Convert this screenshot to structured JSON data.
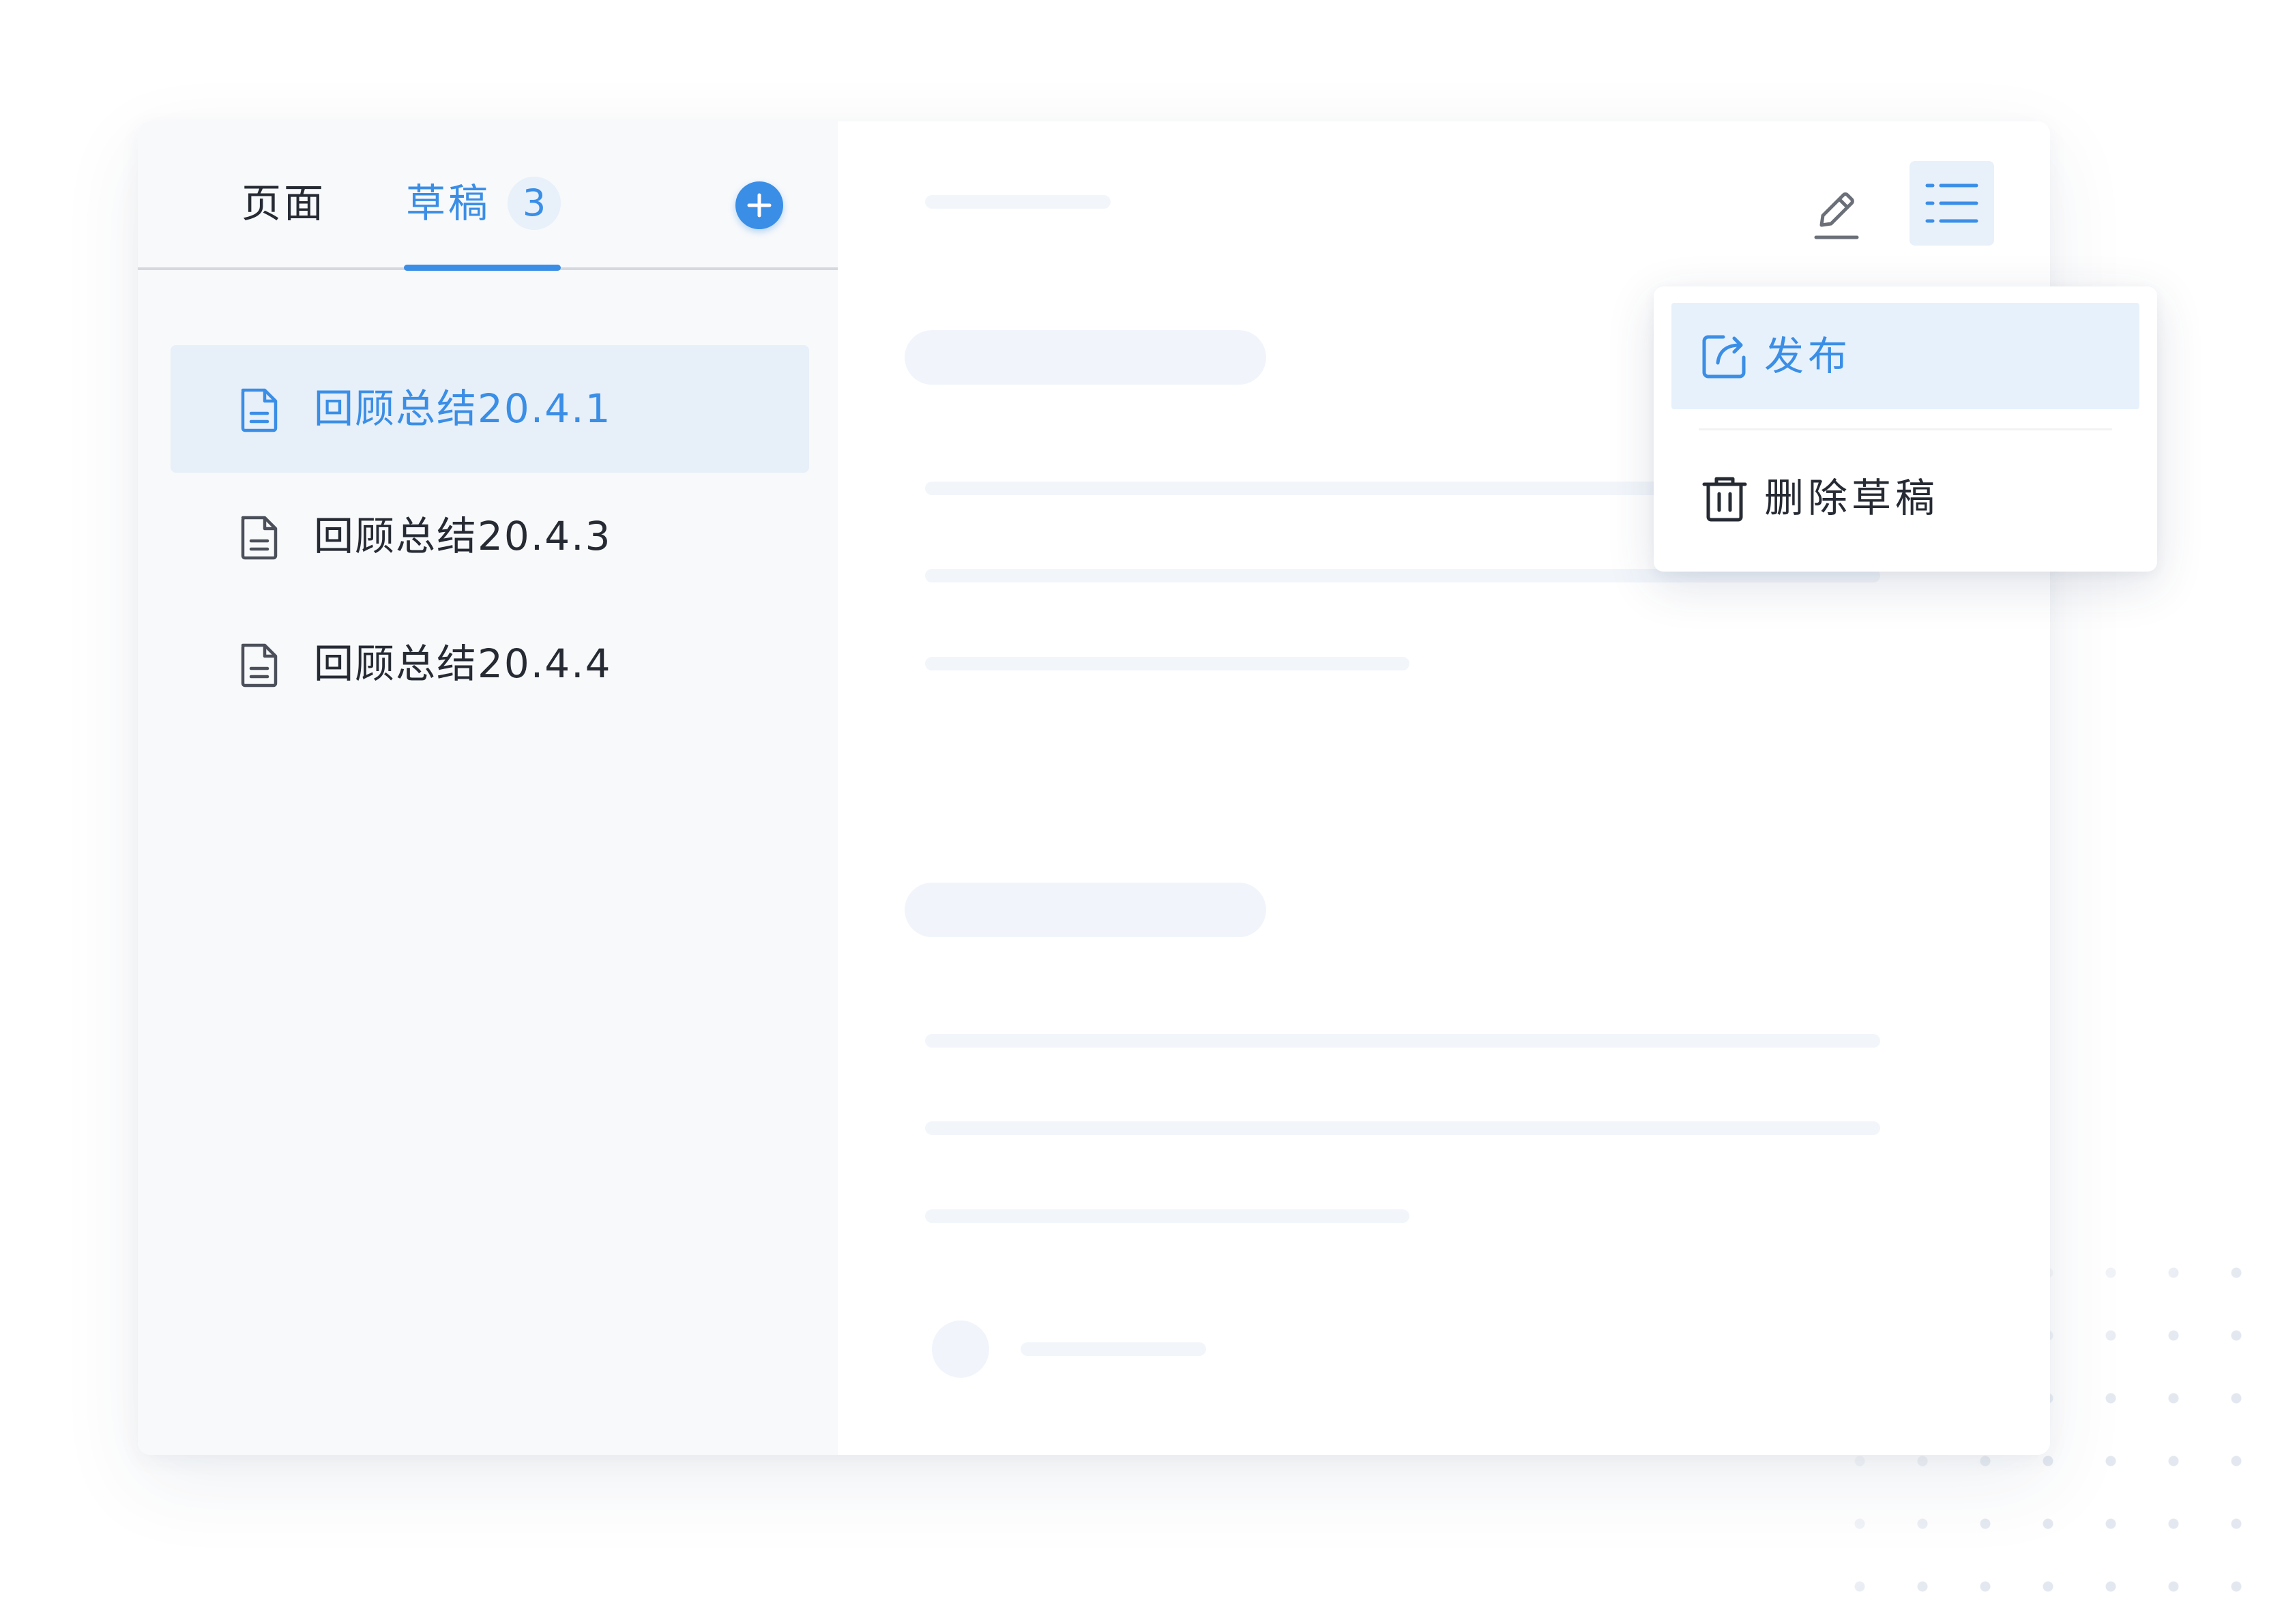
{
  "sidebar": {
    "tabs": [
      {
        "label": "页面",
        "active": false
      },
      {
        "label": "草稿",
        "active": true,
        "badge": "3"
      }
    ],
    "documents": [
      {
        "label": "回顾总结20.4.1",
        "active": true
      },
      {
        "label": "回顾总结20.4.3",
        "active": false
      },
      {
        "label": "回顾总结20.4.4",
        "active": false
      }
    ]
  },
  "menu": {
    "items": [
      {
        "label": "发布",
        "icon": "publish-icon",
        "highlighted": true
      },
      {
        "label": "删除草稿",
        "icon": "trash-icon",
        "highlighted": false
      }
    ]
  },
  "colors": {
    "accent": "#3a8ee6",
    "text": "#262a33",
    "active_bg": "#e7eff9",
    "sidebar_bg": "#f8f9fb",
    "skeleton": "#f2f6fb"
  }
}
